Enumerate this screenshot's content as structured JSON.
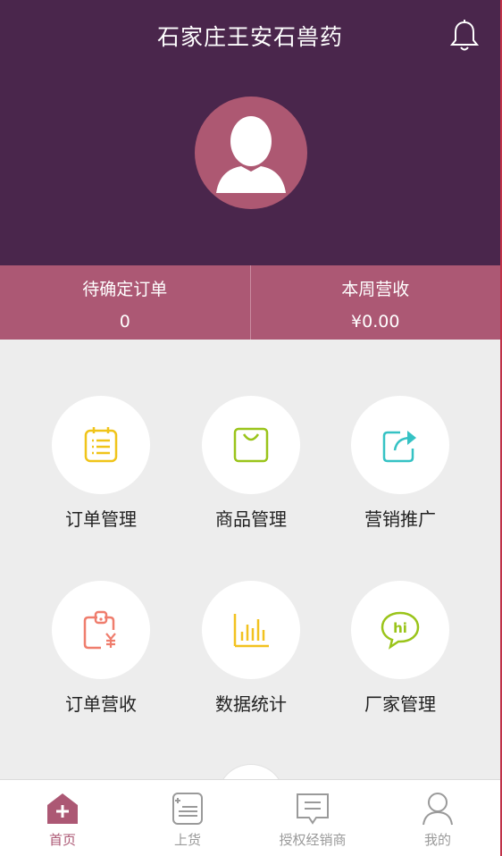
{
  "header": {
    "title": "石家庄王安石兽药"
  },
  "stats": [
    {
      "label": "待确定订单",
      "value": "0"
    },
    {
      "label": "本周营收",
      "value": "¥0.00"
    }
  ],
  "grid": [
    {
      "label": "订单管理",
      "icon": "order-list-icon",
      "color": "#f0c419"
    },
    {
      "label": "商品管理",
      "icon": "shopping-bag-icon",
      "color": "#9ac41a"
    },
    {
      "label": "营销推广",
      "icon": "share-icon",
      "color": "#35c2c4"
    },
    {
      "label": "订单营收",
      "icon": "revenue-icon",
      "color": "#ef7d6d"
    },
    {
      "label": "数据统计",
      "icon": "bar-chart-icon",
      "color": "#f2c21f"
    },
    {
      "label": "厂家管理",
      "icon": "chat-hi-icon",
      "color": "#9ac41a"
    }
  ],
  "tabbar": [
    {
      "label": "首页",
      "icon": "home-icon",
      "active": true
    },
    {
      "label": "上货",
      "icon": "stock-icon",
      "active": false
    },
    {
      "label": "授权经销商",
      "icon": "message-icon",
      "active": false
    },
    {
      "label": "我的",
      "icon": "user-icon",
      "active": false
    }
  ],
  "colors": {
    "header": "#4a264c",
    "accent": "#ac5874",
    "background": "#ededed"
  }
}
